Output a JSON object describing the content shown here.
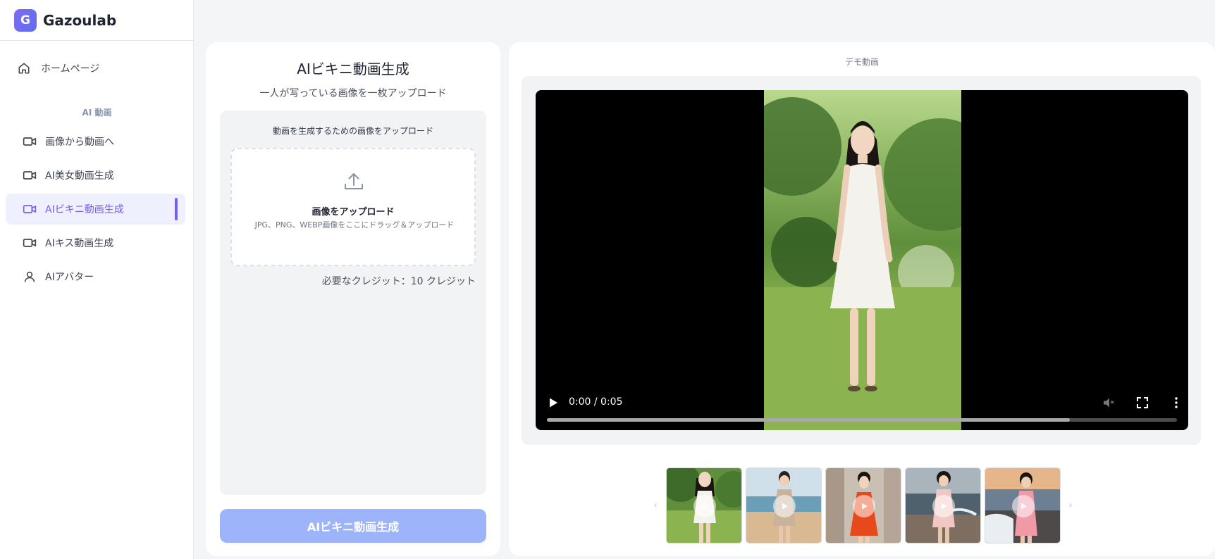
{
  "sidebar": {
    "brand": {
      "letter": "G",
      "name": "Gazoulab"
    },
    "home": {
      "label": "ホームページ",
      "icon": "home-icon"
    },
    "section_label": "AI 動画",
    "items": [
      {
        "label": "画像から動画へ",
        "icon": "video-camera-icon",
        "active": false
      },
      {
        "label": "AI美女動画生成",
        "icon": "video-camera-icon",
        "active": false
      },
      {
        "label": "AIビキニ動画生成",
        "icon": "video-camera-icon",
        "active": true
      },
      {
        "label": "AIキス動画生成",
        "icon": "video-camera-icon",
        "active": false
      },
      {
        "label": "AIアバター",
        "icon": "user-icon",
        "active": false
      }
    ],
    "accent": "#7b5cf0"
  },
  "generator": {
    "title": "AIビキニ動画生成",
    "subtitle": "一人が写っている画像を一枚アップロード",
    "upload_hint": "動画を生成するための画像をアップロード",
    "dropzone": {
      "icon": "upload-icon",
      "title": "画像をアップロード",
      "description": "JPG、PNG、WEBP画像をここにドラッグ＆アップロード"
    },
    "credits": "必要なクレジット：10 クレジット",
    "button_label": "AIビキニ動画生成",
    "button_color": "#9db4fb"
  },
  "demo": {
    "label": "デモ動画",
    "player": {
      "time": "0:00 / 0:05",
      "buffered_fraction": 0.83
    },
    "thumbnails": [
      {
        "name": "white-dress-park",
        "icon": "play-icon"
      },
      {
        "name": "beige-dress-beach",
        "icon": "play-icon"
      },
      {
        "name": "red-dress-street",
        "icon": "play-icon"
      },
      {
        "name": "pink-dress-beach",
        "icon": "play-icon"
      },
      {
        "name": "pink-dress-sunset-rocks",
        "icon": "play-icon"
      }
    ]
  }
}
